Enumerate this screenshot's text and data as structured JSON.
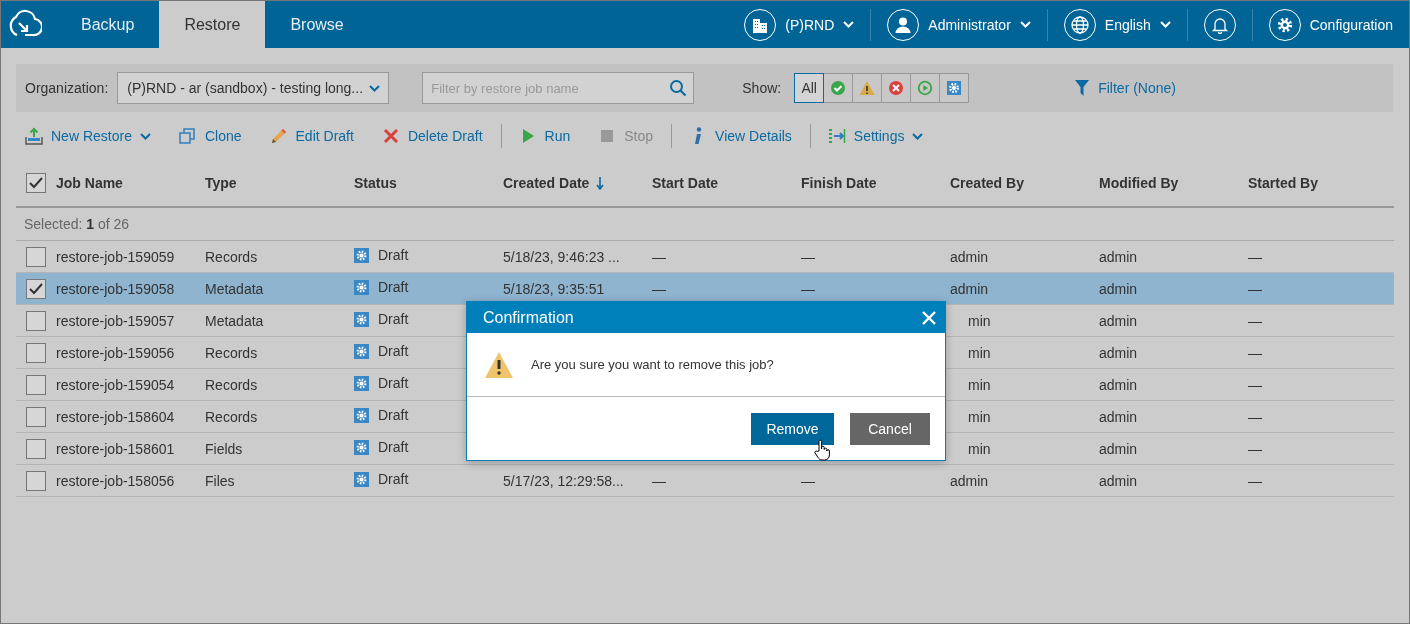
{
  "nav": {
    "tabs": [
      {
        "label": "Backup",
        "selected": false
      },
      {
        "label": "Restore",
        "selected": true
      },
      {
        "label": "Browse",
        "selected": false
      }
    ],
    "menus": [
      {
        "kind": "organization",
        "label": "(P)RND",
        "dropdown": true
      },
      {
        "kind": "user",
        "label": "Administrator",
        "dropdown": true
      },
      {
        "kind": "language",
        "label": "English",
        "dropdown": true
      },
      {
        "kind": "notifications",
        "dropdown": false
      },
      {
        "kind": "configuration",
        "label": "Configuration",
        "dropdown": false
      }
    ]
  },
  "filter_bar": {
    "organization_label": "Organization:",
    "organization_value": "(P)RND - ar (sandbox) - testing long...",
    "search": {
      "placeholder": "Filter by restore job name"
    },
    "show_label": "Show:",
    "show_filters": [
      {
        "kind": "all",
        "label": "All",
        "selected": true
      },
      {
        "kind": "success",
        "selected": false
      },
      {
        "kind": "warning",
        "selected": false
      },
      {
        "kind": "error",
        "selected": false
      },
      {
        "kind": "running",
        "selected": false
      },
      {
        "kind": "draft",
        "selected": false
      }
    ],
    "filter_link": "Filter (None)"
  },
  "toolbar": [
    {
      "kind": "new",
      "label": "New Restore",
      "dropdown": true,
      "disabled": false
    },
    {
      "kind": "clone",
      "label": "Clone",
      "dropdown": false,
      "disabled": false
    },
    {
      "kind": "edit",
      "label": "Edit Draft",
      "dropdown": false,
      "disabled": false
    },
    {
      "kind": "delete",
      "label": "Delete Draft",
      "dropdown": false,
      "disabled": false
    },
    {
      "kind": "divider"
    },
    {
      "kind": "run",
      "label": "Run",
      "dropdown": false,
      "disabled": false
    },
    {
      "kind": "stop",
      "label": "Stop",
      "dropdown": false,
      "disabled": true
    },
    {
      "kind": "divider"
    },
    {
      "kind": "details",
      "label": "View Details",
      "dropdown": false,
      "disabled": false
    },
    {
      "kind": "divider"
    },
    {
      "kind": "settings",
      "label": "Settings",
      "dropdown": true,
      "disabled": false
    }
  ],
  "table": {
    "all_checked": true,
    "columns": [
      {
        "label": "Job Name",
        "sorted": false
      },
      {
        "label": "Type",
        "sorted": false
      },
      {
        "label": "Status",
        "sorted": false
      },
      {
        "label": "Created Date",
        "sorted": true
      },
      {
        "label": "Start Date",
        "sorted": false
      },
      {
        "label": "Finish Date",
        "sorted": false
      },
      {
        "label": "Created By",
        "sorted": false
      },
      {
        "label": "Modified By",
        "sorted": false
      },
      {
        "label": "Started By",
        "sorted": false
      }
    ],
    "selection_summary": "Selected: **1** of 26",
    "rows": [
      {
        "checked": false,
        "selected": false,
        "cells": [
          "restore-job-159059",
          "Records",
          "Draft",
          "5/18/23, 9:46:23 ...",
          "—",
          "—",
          "admin",
          "admin",
          "—"
        ]
      },
      {
        "checked": true,
        "selected": true,
        "cells": [
          "restore-job-159058",
          "Metadata",
          "Draft",
          "5/18/23, 9:35:51",
          "—",
          "—",
          "admin",
          "admin",
          "—"
        ]
      },
      {
        "checked": false,
        "selected": false,
        "cells": [
          "restore-job-159057",
          "Metadata",
          "Draft",
          "",
          "",
          "",
          "min",
          "admin",
          "—"
        ]
      },
      {
        "checked": false,
        "selected": false,
        "cells": [
          "restore-job-159056",
          "Records",
          "Draft",
          "",
          "",
          "",
          "min",
          "admin",
          "—"
        ]
      },
      {
        "checked": false,
        "selected": false,
        "cells": [
          "restore-job-159054",
          "Records",
          "Draft",
          "",
          "",
          "",
          "min",
          "admin",
          "—"
        ]
      },
      {
        "checked": false,
        "selected": false,
        "cells": [
          "restore-job-158604",
          "Records",
          "Draft",
          "",
          "",
          "",
          "min",
          "admin",
          "—"
        ]
      },
      {
        "checked": false,
        "selected": false,
        "cells": [
          "restore-job-158601",
          "Fields",
          "Draft",
          "",
          "",
          "",
          "min",
          "admin",
          "—"
        ]
      },
      {
        "checked": false,
        "selected": false,
        "cells": [
          "restore-job-158056",
          "Files",
          "Draft",
          "5/17/23, 12:29:58...",
          "—",
          "—",
          "admin",
          "admin",
          "—"
        ]
      }
    ]
  },
  "dialog": {
    "title": "Confirmation",
    "message": "Are you sure you want to remove this job?",
    "buttons": [
      {
        "label": "Remove",
        "kind": "primary"
      },
      {
        "label": "Cancel",
        "kind": "secondary"
      }
    ]
  }
}
